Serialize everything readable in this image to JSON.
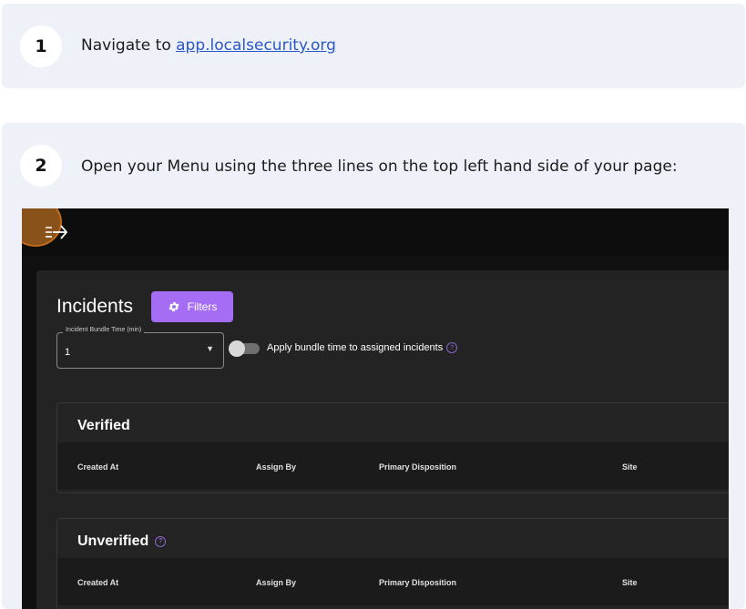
{
  "steps": [
    {
      "number": "1",
      "text": "Navigate to ",
      "link": "app.localsecurity.org"
    },
    {
      "number": "2",
      "text": "Open your Menu using the three lines on the top left hand side of your page:"
    }
  ],
  "app": {
    "title": "Incidents",
    "filters_label": "Filters",
    "bundle_field": {
      "label": "Incident Bundle Time (min)",
      "value": "1"
    },
    "toggle_label": "Apply bundle time to assigned incidents",
    "help_glyph": "?",
    "sections": [
      {
        "title": "Verified",
        "columns": [
          "Created At",
          "Assign By",
          "Primary Disposition",
          "Site"
        ]
      },
      {
        "title": "Unverified",
        "columns": [
          "Created At",
          "Assign By",
          "Primary Disposition",
          "Site"
        ]
      }
    ]
  },
  "colors": {
    "card_bg": "#eef1f7",
    "accent": "#a56cf4",
    "link": "#2a57c9",
    "highlight": "#c26a1c"
  }
}
